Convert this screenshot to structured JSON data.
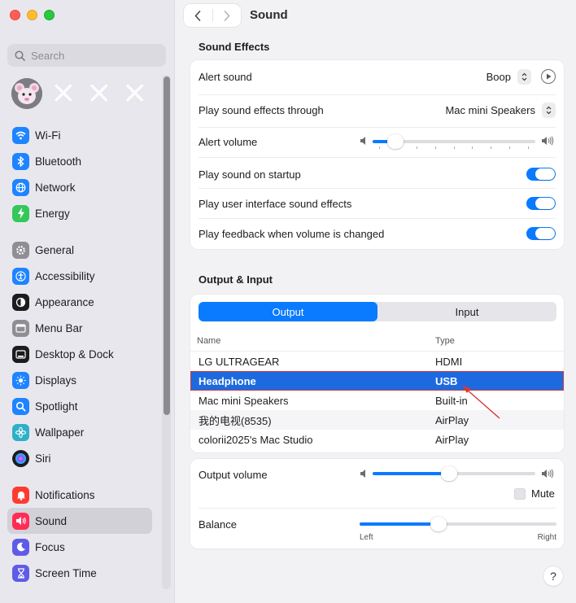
{
  "window": {
    "title": "Sound"
  },
  "colors": {
    "accent": "#0a7aff",
    "selection": "#1d6ae0",
    "annotation": "#d53a3a"
  },
  "sidebar": {
    "search_placeholder": "Search",
    "items_group1": [
      {
        "label": "Wi-Fi",
        "icon": "wifi-icon",
        "color": "#1e84ff"
      },
      {
        "label": "Bluetooth",
        "icon": "bluetooth-icon",
        "color": "#1e84ff"
      },
      {
        "label": "Network",
        "icon": "globe-icon",
        "color": "#1e84ff"
      },
      {
        "label": "Energy",
        "icon": "bolt-icon",
        "color": "#34c759"
      }
    ],
    "items_group2": [
      {
        "label": "General",
        "icon": "gear-icon",
        "color": "#8e8e93"
      },
      {
        "label": "Accessibility",
        "icon": "accessibility-icon",
        "color": "#1e84ff"
      },
      {
        "label": "Appearance",
        "icon": "appearance-icon",
        "color": "#1c1c1e"
      },
      {
        "label": "Menu Bar",
        "icon": "menubar-icon",
        "color": "#8e8e93"
      },
      {
        "label": "Desktop & Dock",
        "icon": "dock-icon",
        "color": "#1c1c1e"
      },
      {
        "label": "Displays",
        "icon": "sun-icon",
        "color": "#1e84ff"
      },
      {
        "label": "Spotlight",
        "icon": "magnifier-icon",
        "color": "#1e84ff"
      },
      {
        "label": "Wallpaper",
        "icon": "flower-icon",
        "color": "#30b0c7"
      },
      {
        "label": "Siri",
        "icon": "siri-icon",
        "color": "#1c1c1e"
      }
    ],
    "items_group3": [
      {
        "label": "Notifications",
        "icon": "bell-icon",
        "color": "#ff3b30"
      },
      {
        "label": "Sound",
        "icon": "speaker-icon",
        "color": "#ff2d55",
        "active": true
      },
      {
        "label": "Focus",
        "icon": "moon-icon",
        "color": "#5e5ce6"
      },
      {
        "label": "Screen Time",
        "icon": "hourglass-icon",
        "color": "#5e5ce6"
      }
    ]
  },
  "sound_effects": {
    "heading": "Sound Effects",
    "alert_sound": {
      "label": "Alert sound",
      "value": "Boop"
    },
    "through": {
      "label": "Play sound effects through",
      "value": "Mac mini Speakers"
    },
    "alert_volume": {
      "label": "Alert volume",
      "level": 0.14
    },
    "startup": {
      "label": "Play sound on startup",
      "on": true
    },
    "ui_sounds": {
      "label": "Play user interface sound effects",
      "on": true
    },
    "feedback": {
      "label": "Play feedback when volume is changed",
      "on": true
    }
  },
  "output_input": {
    "heading": "Output & Input",
    "tabs": [
      "Output",
      "Input"
    ],
    "active_tab": "Output",
    "columns": [
      "Name",
      "Type"
    ],
    "devices": [
      {
        "name": "LG ULTRAGEAR",
        "type": "HDMI"
      },
      {
        "name": "Headphone",
        "type": "USB",
        "selected": true
      },
      {
        "name": "Mac mini Speakers",
        "type": "Built-in"
      },
      {
        "name": "我的电视(8535)",
        "type": "AirPlay"
      },
      {
        "name": "colorii2025's Mac Studio",
        "type": "AirPlay"
      }
    ],
    "output_volume": {
      "label": "Output volume",
      "level": 0.47
    },
    "mute": {
      "label": "Mute",
      "checked": false
    },
    "balance": {
      "label": "Balance",
      "left": "Left",
      "right": "Right",
      "level": 0.4
    }
  },
  "help": "?"
}
